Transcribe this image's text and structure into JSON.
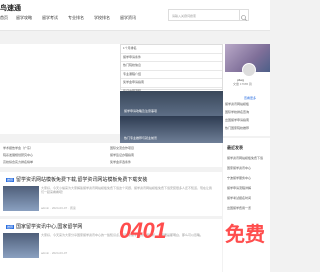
{
  "header": {
    "logo": "鸟速通",
    "nav": [
      "首页",
      "留学攻略",
      "留学考试",
      "专业排名",
      "学校排名",
      "留学资讯"
    ],
    "search_placeholder": "请输入关键词搜索"
  },
  "table": {
    "rows": [
      "1个月排名",
      "留学申请条件",
      "热门院校信息",
      "专业课程介绍",
      "奖学金申请指南",
      "签证办理流程"
    ]
  },
  "hero": [
    {
      "caption": "留学申请攻略及注意事项"
    },
    {
      "caption": "热门专业推荐与就业前景"
    }
  ],
  "sidebar": {
    "name": "pfiwg",
    "stats": "文章 17965 篇",
    "more": "查看更多",
    "links": [
      "留学资讯网站模板",
      "国际学校排名查询",
      "出国留学申请指南",
      "热门国家院校推荐"
    ]
  },
  "links_row": [
    "学术报告学会（广东）",
    "院系发展规划研究中心",
    "高校综合实力排名榜单",
    "国际交流合作项目",
    "留学签证办理指南",
    "奖学金评选条件"
  ],
  "articles": [
    {
      "badge": "推荐",
      "title": "留学资讯网站模板免费下载,留学资讯网站模板免费下载安装",
      "text": "大家好，今天小编来为大家解答留学资讯网站模板免费下载这个问题，留学资讯网站模板免费下载安装很多人还不知道，现在让我们一起来看看吧！",
      "meta": "admin · 2024-03-07 · 阅读"
    },
    {
      "badge": "推荐",
      "title": "国家留学资讯中心,国家留学网",
      "text": "大家好，今天来为大家分享国家留学资讯中心的一些知识点，和国家留学网的问题解析，大家要是都明白，那么可以忽略。",
      "meta": "admin · 2024-03-07"
    }
  ],
  "right_list": {
    "title": "最近发表",
    "items": [
      "留学资讯网站模板免费下载",
      "国家留学资讯中心",
      "宁波留学服务中心",
      "留学申请流程详解",
      "留学考试报名时间",
      "出国留学费用一览"
    ]
  },
  "watermark": {
    "number": "0401",
    "text": "免费"
  }
}
